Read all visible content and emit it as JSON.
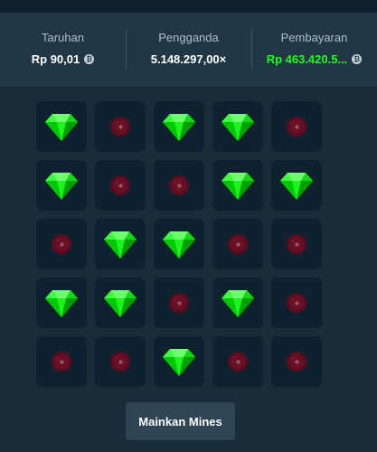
{
  "stats": [
    {
      "label": "Taruhan",
      "value": "Rp 90,01",
      "coin_symbol": "₿",
      "highlight": false
    },
    {
      "label": "Pengganda",
      "value": "5.148.297,00×",
      "coin_symbol": "",
      "highlight": false
    },
    {
      "label": "Pembayaran",
      "value": "Rp 463.420.5...",
      "coin_symbol": "₿",
      "highlight": true
    }
  ],
  "board": {
    "columns": 5,
    "tiles": [
      "gem",
      "mine",
      "gem",
      "gem",
      "mine",
      "gem",
      "mine",
      "mine",
      "gem",
      "gem",
      "mine",
      "gem",
      "gem",
      "mine",
      "mine",
      "gem",
      "gem",
      "mine",
      "gem",
      "mine",
      "mine",
      "mine",
      "gem",
      "mine",
      "mine"
    ]
  },
  "play_button": {
    "label": "Mainkan Mines"
  },
  "colors": {
    "background": "#1a2c38",
    "panel": "#213743",
    "tile": "#0f212e",
    "gem": "#00e701",
    "mine": "#6b0f24",
    "payout_text": "#1fff20",
    "button": "#2f4553"
  },
  "icons": {
    "gem": "gem-icon",
    "mine": "mine-icon",
    "coin": "coin-icon"
  }
}
